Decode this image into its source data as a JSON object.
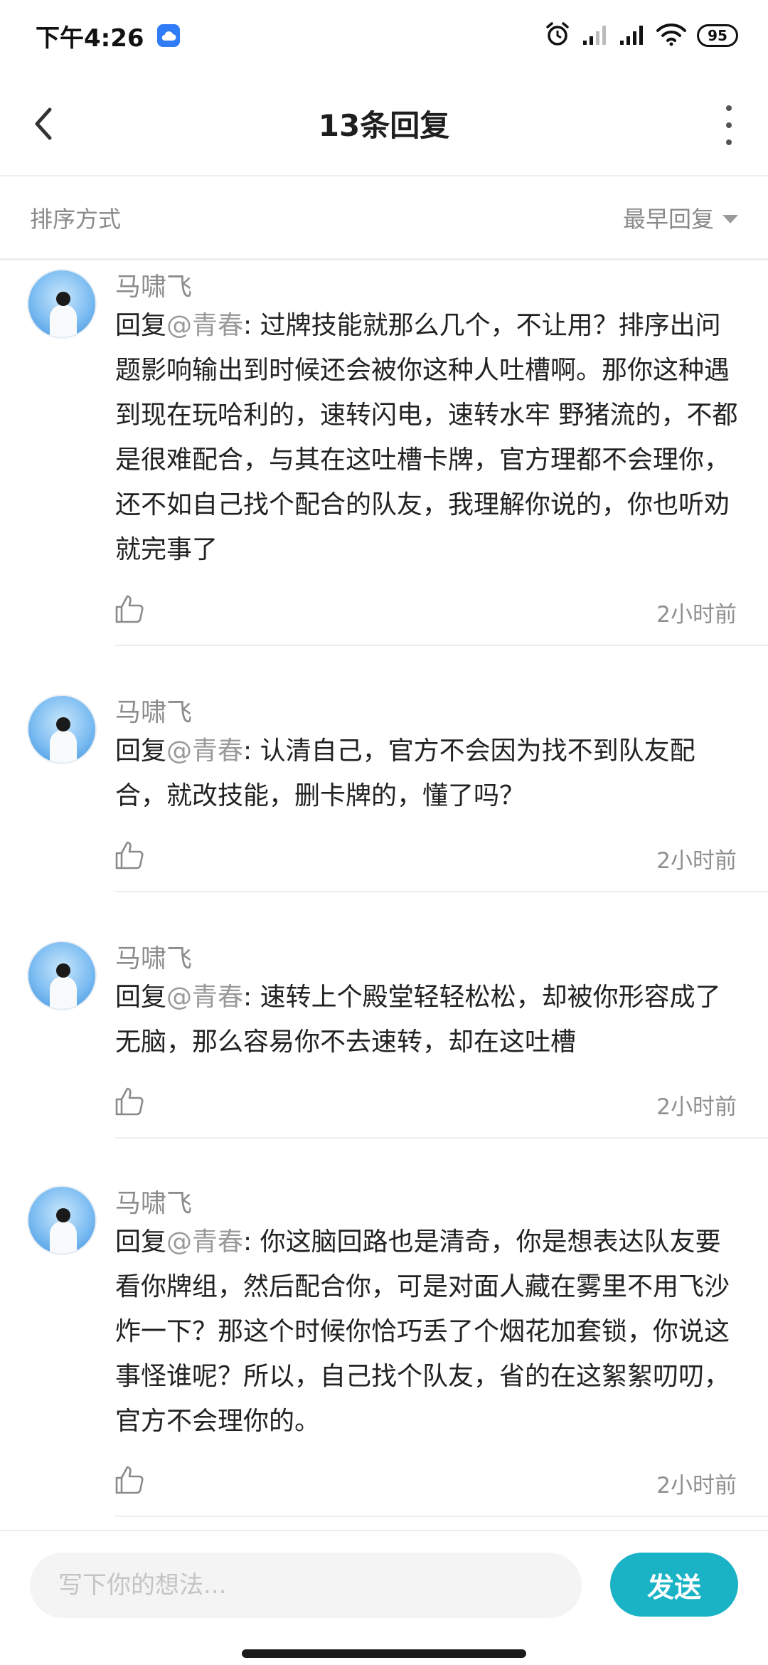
{
  "status_bar": {
    "time": "下午4:26",
    "battery": "95"
  },
  "header": {
    "title": "13条回复"
  },
  "sort": {
    "label": "排序方式",
    "selected": "最早回复"
  },
  "comments": [
    {
      "username": "马啸飞",
      "prefix": "回复",
      "mention": "@青春",
      "text": ": 过牌技能就那么几个，不让用？排序出问题影响输出到时候还会被你这种人吐槽啊。那你这种遇到现在玩哈利的，速转闪电，速转水牢 野猪流的，不都是很难配合，与其在这吐槽卡牌，官方理都不会理你，还不如自己找个配合的队友，我理解你说的，你也听劝就完事了",
      "time": "2小时前"
    },
    {
      "username": "马啸飞",
      "prefix": "回复",
      "mention": "@青春",
      "text": ": 认清自己，官方不会因为找不到队友配合，就改技能，删卡牌的，懂了吗？",
      "time": "2小时前"
    },
    {
      "username": "马啸飞",
      "prefix": "回复",
      "mention": "@青春",
      "text": ": 速转上个殿堂轻轻松松，却被你形容成了无脑，那么容易你不去速转，却在这吐槽",
      "time": "2小时前"
    },
    {
      "username": "马啸飞",
      "prefix": "回复",
      "mention": "@青春",
      "text": ": 你这脑回路也是清奇，你是想表达队友要看你牌组，然后配合你，可是对面人藏在雾里不用飞沙炸一下？那这个时候你恰巧丢了个烟花加套锁，你说这事怪谁呢？所以，自己找个队友，省的在这絮絮叨叨，官方不会理你的。",
      "time": "2小时前"
    }
  ],
  "composer": {
    "placeholder": "写下你的想法...",
    "send_label": "发送"
  }
}
